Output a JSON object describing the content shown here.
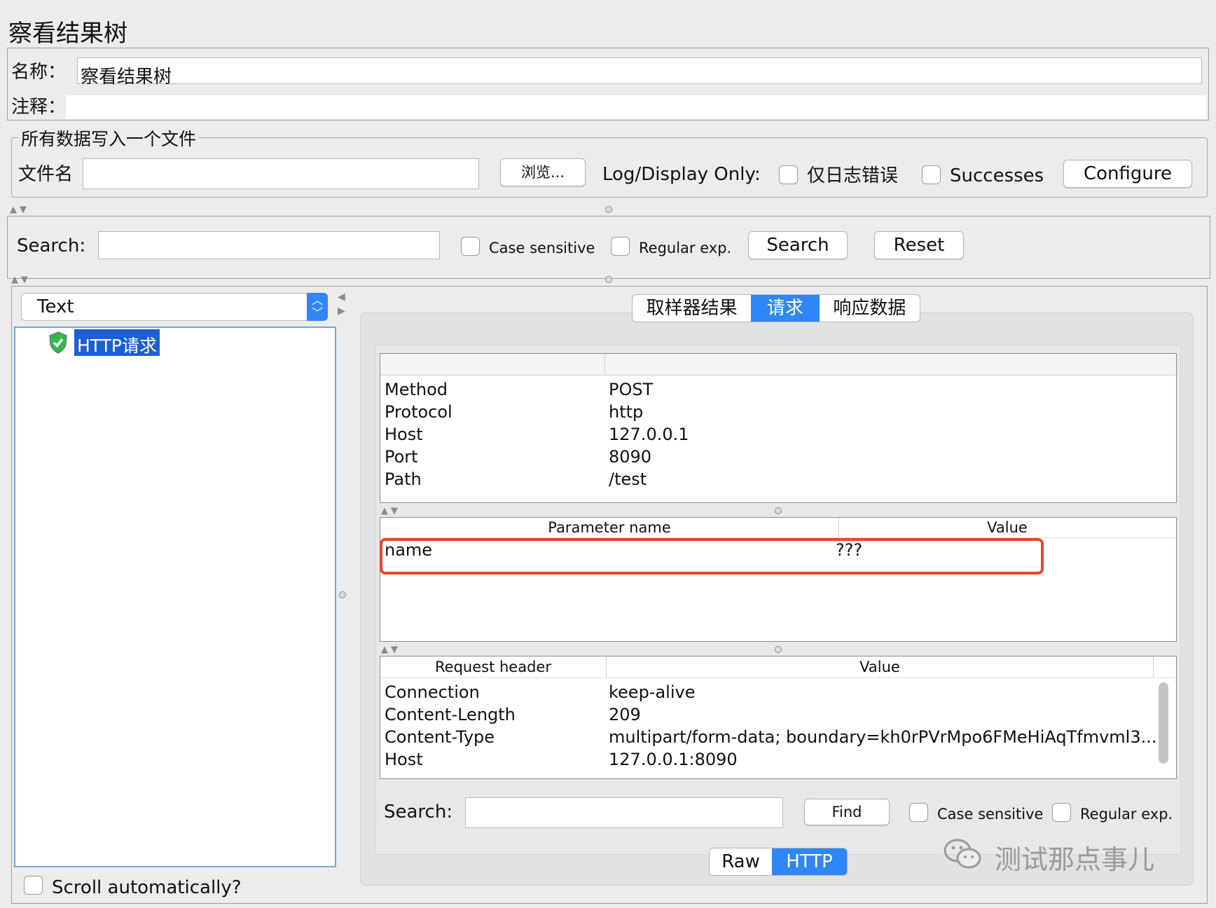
{
  "window_title": "察看结果树",
  "form": {
    "name_label": "名称：",
    "name_value": "察看结果树",
    "comment_label": "注释："
  },
  "file_section": {
    "legend": "所有数据写入一个文件",
    "filename_label": "文件名",
    "browse_label": "浏览...",
    "log_display_label": "Log/Display Only:",
    "errors_only_label": "仅日志错误",
    "successes_label": "Successes",
    "configure_label": "Configure"
  },
  "search_bar": {
    "label": "Search:",
    "case_sensitive_label": "Case sensitive",
    "regex_label": "Regular exp.",
    "search_button": "Search",
    "reset_button": "Reset"
  },
  "left_panel": {
    "renderer_value": "Text",
    "tree_item": "HTTP请求",
    "scroll_auto_label": "Scroll automatically?"
  },
  "result_tabs": {
    "tabs": [
      "取样器结果",
      "请求",
      "响应数据"
    ],
    "active_index": 1
  },
  "request_info": {
    "rows": [
      {
        "key": "Method",
        "value": "POST"
      },
      {
        "key": "Protocol",
        "value": "http"
      },
      {
        "key": "Host",
        "value": "127.0.0.1"
      },
      {
        "key": "Port",
        "value": "8090"
      },
      {
        "key": "Path",
        "value": "/test"
      }
    ]
  },
  "params_table": {
    "headers": [
      "Parameter name",
      "Value"
    ],
    "rows": [
      {
        "name": "name",
        "value": "???"
      }
    ],
    "highlight_color": "#e8452c"
  },
  "headers_table": {
    "headers": [
      "Request header",
      "Value"
    ],
    "rows": [
      {
        "name": "Connection",
        "value": "keep-alive"
      },
      {
        "name": "Content-Length",
        "value": "209"
      },
      {
        "name": "Content-Type",
        "value": "multipart/form-data; boundary=kh0rPVrMpo6FMeHiAqTfmvml3..."
      },
      {
        "name": "Host",
        "value": "127.0.0.1:8090"
      }
    ]
  },
  "find_bar": {
    "label": "Search:",
    "find_button": "Find",
    "case_sensitive_label": "Case sensitive",
    "regex_label": "Regular exp."
  },
  "bottom_tabs": {
    "tabs": [
      "Raw",
      "HTTP"
    ],
    "active_index": 1
  },
  "watermark": {
    "text": "测试那点事儿"
  },
  "colors": {
    "accent": "#2f86f6",
    "selection": "#1b5fd6",
    "tree_border": "#6aa8e8"
  }
}
